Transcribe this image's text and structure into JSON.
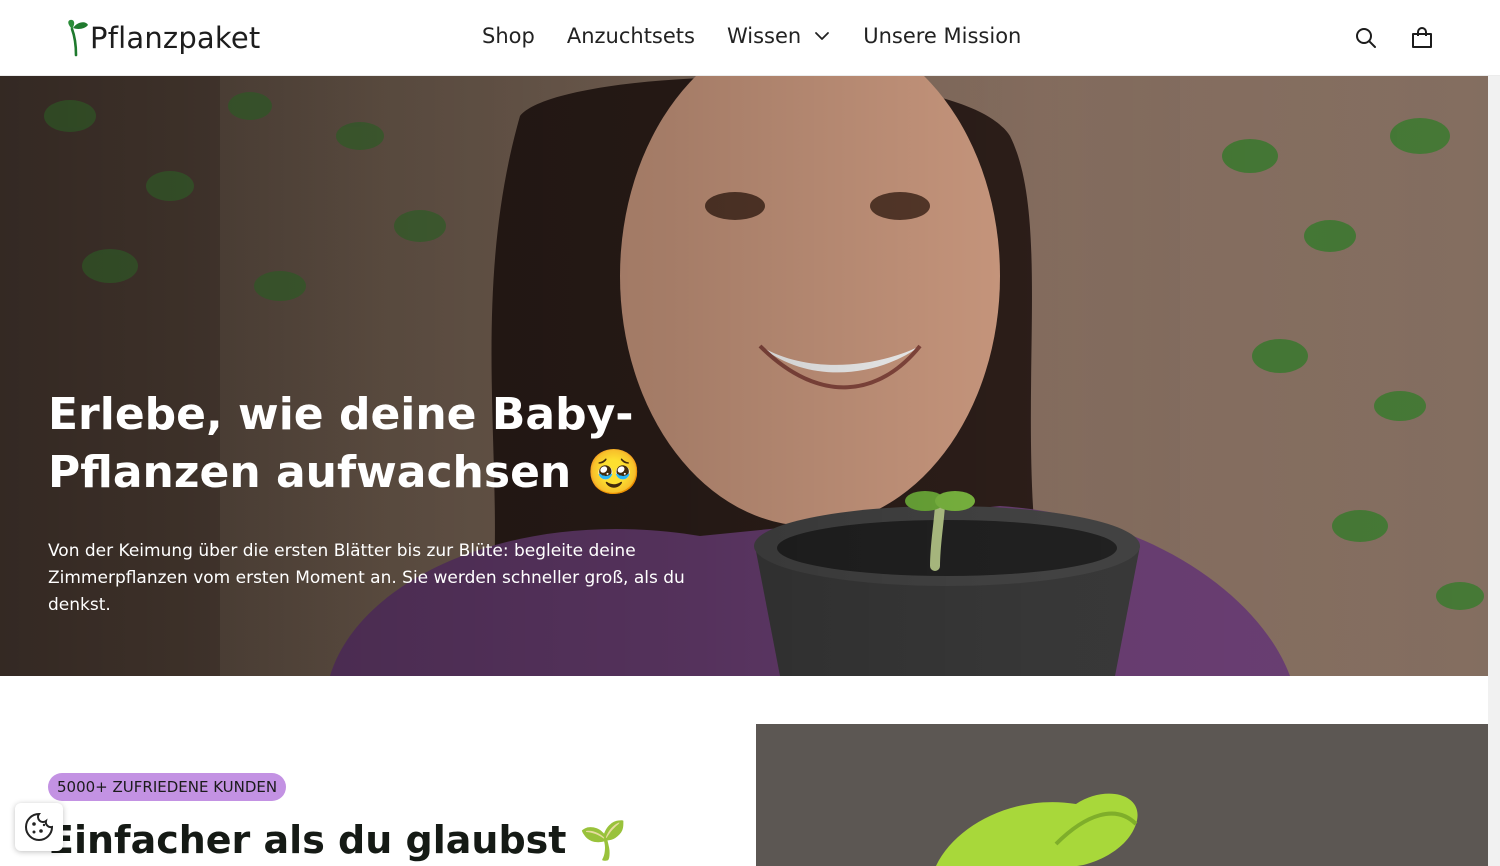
{
  "header": {
    "logo_text": "Pflanzpaket",
    "nav": [
      {
        "label": "Shop"
      },
      {
        "label": "Anzuchtsets"
      },
      {
        "label": "Wissen",
        "has_dropdown": true
      },
      {
        "label": "Unsere Mission"
      }
    ],
    "icons": [
      "search-icon",
      "cart-icon"
    ]
  },
  "hero": {
    "title": "Erlebe, wie deine Baby-Pflanzen aufwachsen 🥹",
    "subtitle": "Von der Keimung über die ersten Blätter bis zur Blüte: begleite deine Zimmerpflanzen vom ersten Moment an. Sie werden schneller groß, als du denkst."
  },
  "section": {
    "badge": "5000+ ZUFRIEDENE KUNDEN",
    "title": "Einfacher als du glaubst 🌱"
  },
  "colors": {
    "accent_green": "#1f7a2e",
    "badge_purple": "#c392e3"
  }
}
